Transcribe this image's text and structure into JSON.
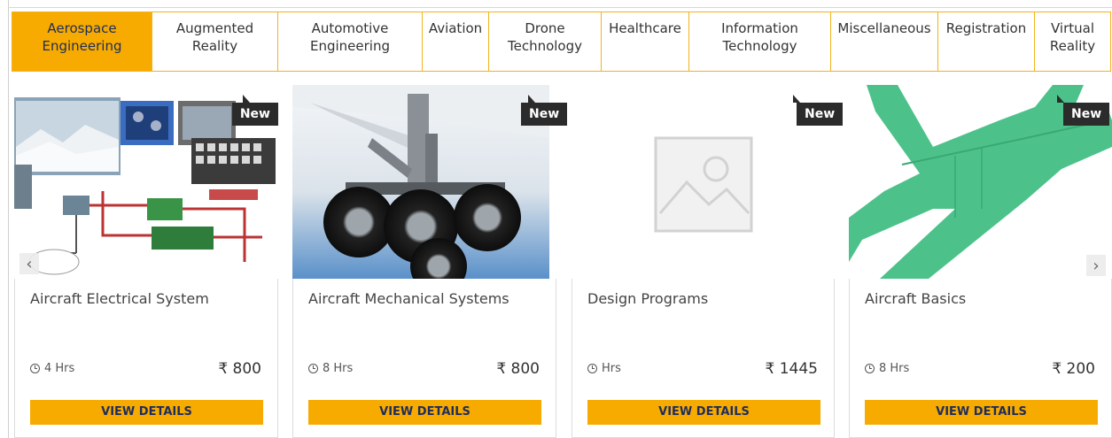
{
  "tabs": [
    {
      "label": "Aerospace\nEngineering",
      "active": true
    },
    {
      "label": "Augmented\nReality"
    },
    {
      "label": "Automotive\nEngineering"
    },
    {
      "label": "Aviation"
    },
    {
      "label": "Drone\nTechnology"
    },
    {
      "label": "Healthcare"
    },
    {
      "label": "Information\nTechnology"
    },
    {
      "label": "Miscellaneous"
    },
    {
      "label": "Registration"
    },
    {
      "label": "Virtual\nReality"
    }
  ],
  "badge_label": "New",
  "courses": [
    {
      "title": "Aircraft Electrical System",
      "duration": "4 Hrs",
      "price": "₹ 800",
      "button": "VIEW DETAILS"
    },
    {
      "title": "Aircraft Mechanical Systems",
      "duration": "8 Hrs",
      "price": "₹ 800",
      "button": "VIEW DETAILS"
    },
    {
      "title": "Design Programs",
      "duration": "Hrs",
      "price": "₹ 1445",
      "button": "VIEW DETAILS"
    },
    {
      "title": "Aircraft Basics",
      "duration": "8 Hrs",
      "price": "₹ 200",
      "button": "VIEW DETAILS"
    }
  ],
  "nav": {
    "prev": "‹",
    "next": "›"
  },
  "colors": {
    "accent": "#f7ab00",
    "accent_text": "#1f2d5c",
    "tab_border": "#f2b21e",
    "plane_green": "#4cc28a",
    "badge_bg": "#2b2b2b"
  }
}
